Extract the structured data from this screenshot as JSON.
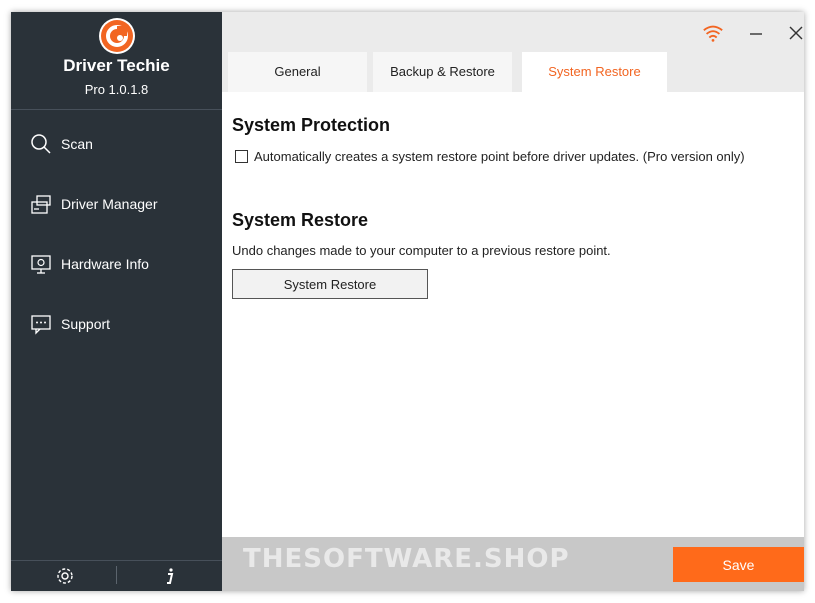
{
  "app": {
    "name": "Driver Techie",
    "version": "Pro 1.0.1.8"
  },
  "sidebar": {
    "items": [
      {
        "label": "Scan",
        "icon": "search-icon"
      },
      {
        "label": "Driver Manager",
        "icon": "driver-manager-icon"
      },
      {
        "label": "Hardware Info",
        "icon": "monitor-icon"
      },
      {
        "label": "Support",
        "icon": "support-chat-icon"
      }
    ],
    "footer": {
      "settings_icon": "gear-icon",
      "info_icon": "info-icon"
    }
  },
  "window_controls": {
    "wifi_icon": "wifi-icon",
    "minimize_icon": "minimize-icon",
    "close_icon": "close-icon"
  },
  "tabs": [
    {
      "label": "General",
      "active": false
    },
    {
      "label": "Backup & Restore",
      "active": false
    },
    {
      "label": "System Restore",
      "active": true
    }
  ],
  "main": {
    "protection_heading": "System Protection",
    "protection_checkbox_label": "Automatically creates a system restore point before driver updates. (Pro version only)",
    "protection_checked": false,
    "restore_heading": "System Restore",
    "restore_description": "Undo changes made to your computer to a previous restore point.",
    "restore_button": "System Restore"
  },
  "footer": {
    "watermark": "THESOFTWARE.SHOP",
    "save_button": "Save"
  },
  "colors": {
    "accent": "#f26522",
    "sidebar_bg": "#2a3239",
    "save_bg": "#ff6a1a"
  }
}
